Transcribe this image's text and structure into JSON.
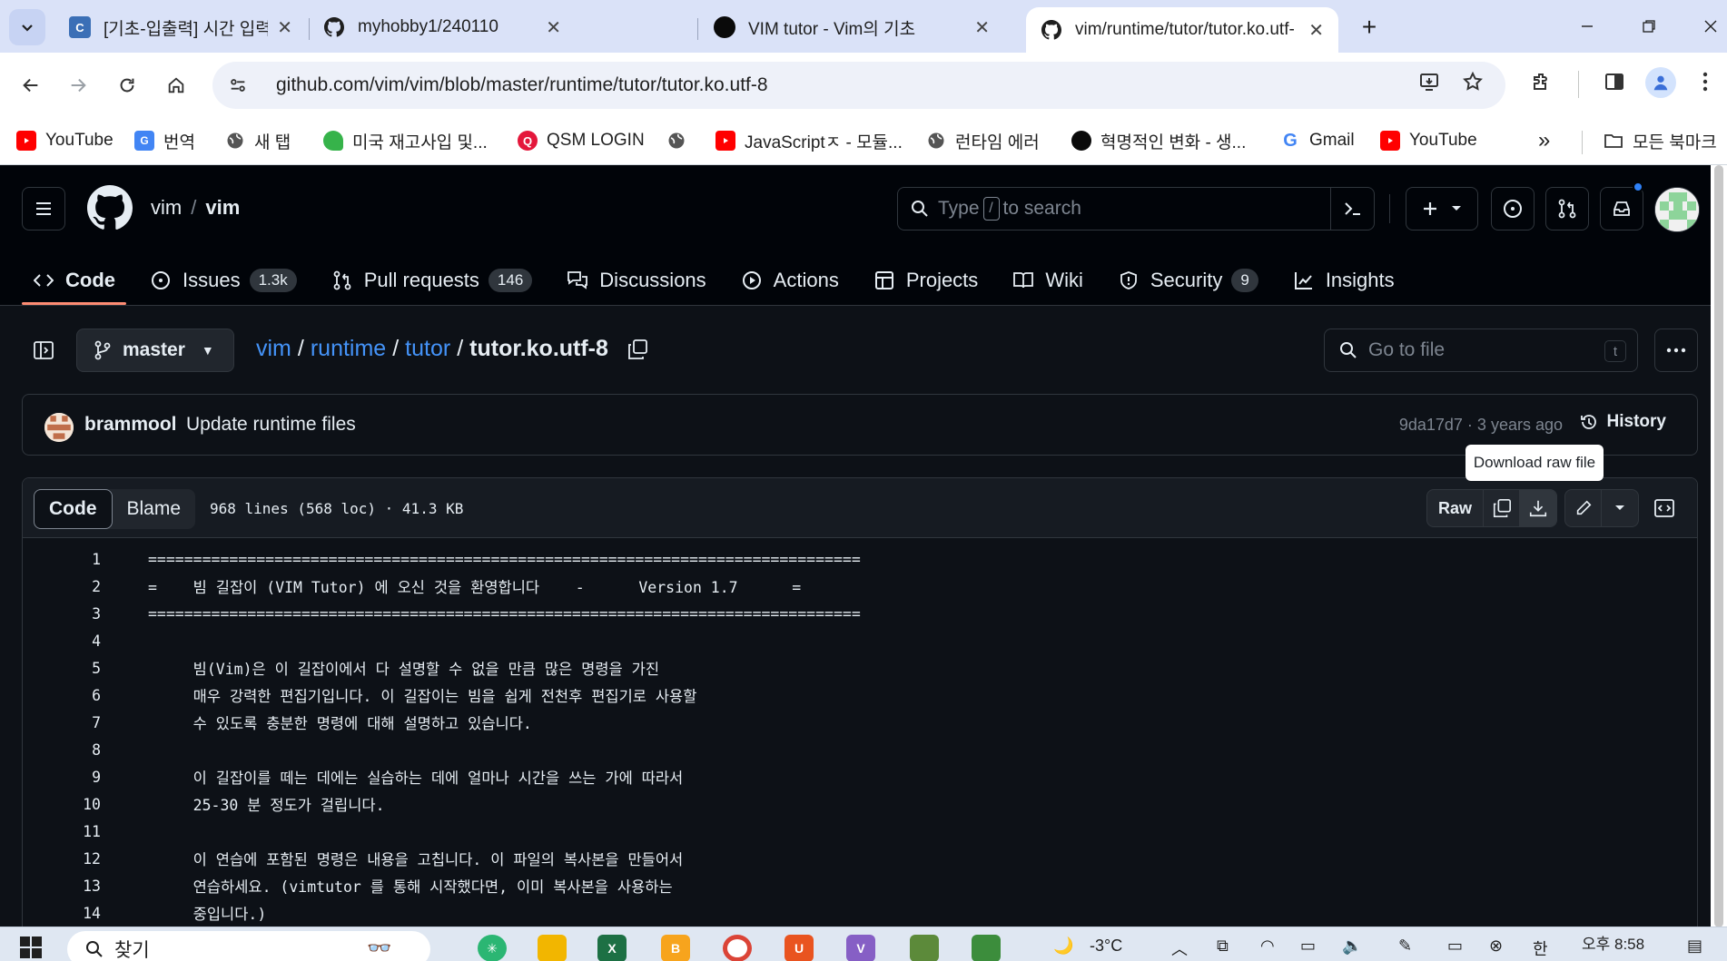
{
  "browser": {
    "tabs": [
      {
        "title": "[기초-입출력] 시간 입력받아 그",
        "favicon": "codeup-icon"
      },
      {
        "title": "myhobby1/240110",
        "favicon": "github-icon"
      },
      {
        "title": "VIM tutor - Vim의 기초",
        "favicon": "black-circle-icon"
      },
      {
        "title": "vim/runtime/tutor/tutor.ko.utf-",
        "favicon": "github-icon",
        "active": true
      }
    ],
    "new_tab": "+",
    "url": "github.com/vim/vim/blob/master/runtime/tutor/tutor.ko.utf-8",
    "bookmarks": [
      {
        "label": "YouTube",
        "icon": "youtube-icon"
      },
      {
        "label": "번역",
        "icon": "translate-icon"
      },
      {
        "label": "새 탭",
        "icon": "globe-icon"
      },
      {
        "label": "미국 재고사입 및...",
        "icon": "leaf-icon"
      },
      {
        "label": "QSM LOGIN",
        "icon": "qsm-icon"
      },
      {
        "label": "",
        "icon": "globe-icon"
      },
      {
        "label": "JavaScriptㅈ - 모듈...",
        "icon": "youtube-icon"
      },
      {
        "label": "런타임 에러",
        "icon": "globe-icon"
      },
      {
        "label": "혁명적인 변화 - 생...",
        "icon": "black-circle-icon"
      },
      {
        "label": "Gmail",
        "icon": "google-icon"
      },
      {
        "label": "YouTube",
        "icon": "youtube-icon"
      }
    ],
    "bookmarks_overflow": "»",
    "all_bookmarks": "모든 북마크"
  },
  "github": {
    "owner": "vim",
    "repo": "vim",
    "search_prefix": "Type",
    "search_key": "/",
    "search_suffix": "to search",
    "nav": [
      {
        "label": "Code",
        "icon": "code-icon",
        "active": true
      },
      {
        "label": "Issues",
        "icon": "issue-icon",
        "count": "1.3k"
      },
      {
        "label": "Pull requests",
        "icon": "pull-request-icon",
        "count": "146"
      },
      {
        "label": "Discussions",
        "icon": "discussion-icon"
      },
      {
        "label": "Actions",
        "icon": "play-icon"
      },
      {
        "label": "Projects",
        "icon": "table-icon"
      },
      {
        "label": "Wiki",
        "icon": "book-icon"
      },
      {
        "label": "Security",
        "icon": "shield-icon",
        "count": "9"
      },
      {
        "label": "Insights",
        "icon": "graph-icon"
      }
    ]
  },
  "file": {
    "branch": "master",
    "path": [
      "vim",
      "runtime",
      "tutor"
    ],
    "filename": "tutor.ko.utf-8",
    "go_to_file": "Go to file",
    "go_to_file_key": "t",
    "commit": {
      "author": "brammool",
      "message": "Update runtime files",
      "sha_time": "9da17d7 · 3 years ago",
      "history": "History"
    },
    "tooltip": "Download raw file",
    "view_tabs": [
      "Code",
      "Blame"
    ],
    "info": "968 lines (568 loc) · 41.3 KB",
    "raw_label": "Raw",
    "lines": [
      {
        "n": "1",
        "t": "==============================================================================="
      },
      {
        "n": "2",
        "t": "=    빔 길잡이 (VIM Tutor) 에 오신 것을 환영합니다    -      Version 1.7      ="
      },
      {
        "n": "3",
        "t": "==============================================================================="
      },
      {
        "n": "4",
        "t": ""
      },
      {
        "n": "5",
        "t": "     빔(Vim)은 이 길잡이에서 다 설명할 수 없을 만큼 많은 명령을 가진"
      },
      {
        "n": "6",
        "t": "     매우 강력한 편집기입니다. 이 길잡이는 빔을 쉽게 전천후 편집기로 사용할"
      },
      {
        "n": "7",
        "t": "     수 있도록 충분한 명령에 대해 설명하고 있습니다."
      },
      {
        "n": "8",
        "t": ""
      },
      {
        "n": "9",
        "t": "     이 길잡이를 떼는 데에는 실습하는 데에 얼마나 시간을 쓰는 가에 따라서"
      },
      {
        "n": "10",
        "t": "     25-30 분 정도가 걸립니다."
      },
      {
        "n": "11",
        "t": ""
      },
      {
        "n": "12",
        "t": "     이 연습에 포함된 명령은 내용을 고칩니다. 이 파일의 복사본을 만들어서"
      },
      {
        "n": "13",
        "t": "     연습하세요. (vimtutor 를 통해 시작했다면, 이미 복사본을 사용하는"
      },
      {
        "n": "14",
        "t": "     중입니다.)"
      }
    ]
  },
  "taskbar": {
    "search": "찾기",
    "weather": "-3°C",
    "ime": "한",
    "clock": "오후 8:58"
  }
}
